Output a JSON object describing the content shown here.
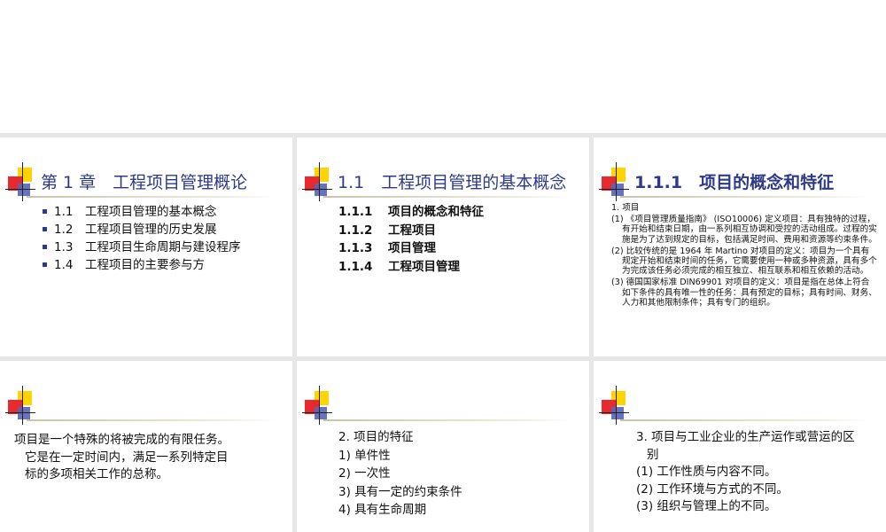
{
  "slides": {
    "s1": {
      "title": "第 1 章　工程项目管理概论",
      "items": [
        "1.1　工程项目管理的基本概念",
        "1.2　工程项目管理的历史发展",
        "1.3　工程项目生命周期与建设程序",
        "1.4　工程项目的主要参与方"
      ]
    },
    "s2": {
      "title": "1.1　工程项目管理的基本概念",
      "items": [
        {
          "num": "1.1.1",
          "text": "项目的概念和特征"
        },
        {
          "num": "1.1.2",
          "text": "工程项目"
        },
        {
          "num": "1.1.3",
          "text": "项目管理"
        },
        {
          "num": "1.1.4",
          "text": "工程项目管理"
        }
      ]
    },
    "s3": {
      "title": "1.1.1　项目的概念和特征",
      "heading": "1. 项目",
      "paras": [
        "(1) 《项目管理质量指南》 (ISO10006) 定义项目：具有独特的过程，有开始和结束日期，由一系列相互协调和受控的活动组成。过程的实施是为了达到规定的目标，包括满足时间、费用和资源等约束条件。",
        "(2) 比较传统的是 1964 年 Martino 对项目的定义：项目为一个具有规定开始和结束时间的任务，它需要使用一种或多种资源，具有多个为完成该任务必须完成的相互独立、相互联系和相互依赖的活动。",
        "(3) 德国国家标准 DIN69901 对项目的定义：项目是指在总体上符合如下条件的具有唯一性的任务：具有预定的目标；具有时间、财务、人力和其他限制条件；具有专门的组织。"
      ]
    },
    "s4": {
      "line1": "项目是一个特殊的将被完成的有限任务。",
      "line2": "它是在一定时间内，满足一系列特定目",
      "line3": "标的多项相关工作的总称。"
    },
    "s5": {
      "items": [
        "2. 项目的特征",
        "1) 单件性",
        "2) 一次性",
        "3) 具有一定的约束条件",
        "4) 具有生命周期"
      ]
    },
    "s6": {
      "line1": "3. 项目与工业企业的生产运作或营运的区",
      "line2": "别",
      "items": [
        "(1) 工作性质与内容不同。",
        "(2) 工作环境与方式的不同。",
        "(3) 组织与管理上的不同。"
      ]
    }
  },
  "colors": {
    "title": "#2e3a87",
    "logo_yellow": "#ffd400",
    "logo_red": "#e8292e",
    "logo_blue": "#5864b7"
  }
}
